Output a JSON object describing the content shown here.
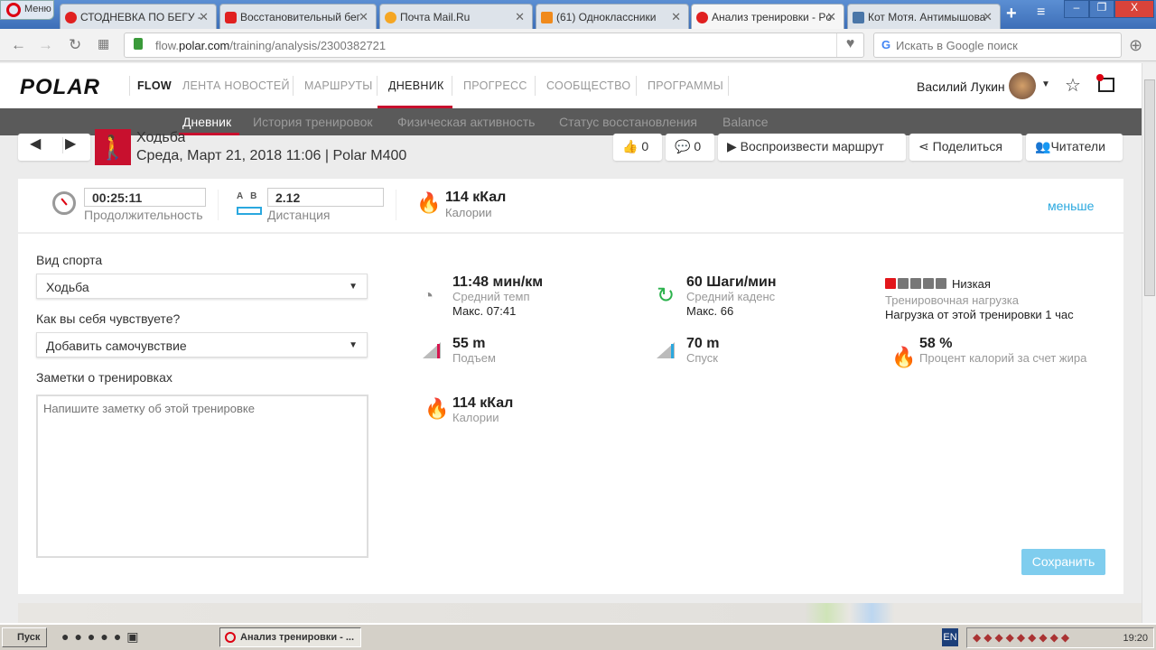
{
  "browser": {
    "menu_label": "Меню",
    "tabs": [
      {
        "title": "СТОДНЕВКА ПО БЕГУ -",
        "color": "#e02020"
      },
      {
        "title": "Восстановительный бег",
        "color": "#e02020"
      },
      {
        "title": "Почта Mail.Ru",
        "color": "#f5a623"
      },
      {
        "title": "(61) Одноклассники",
        "color": "#f08a1c"
      },
      {
        "title": "Анализ тренировки - Po",
        "color": "#e02020"
      },
      {
        "title": "Кот Мотя. Антимышова",
        "color": "#4a76a8"
      }
    ],
    "url_prefix": "flow.",
    "url_domain": "polar.com",
    "url_path": "/training/analysis/2300382721",
    "search_placeholder": "Искать в Google поиск"
  },
  "header": {
    "logo": "POLAR",
    "flow": "FLOW",
    "nav": [
      "ЛЕНТА НОВОСТЕЙ",
      "МАРШРУТЫ",
      "ДНЕВНИК",
      "ПРОГРЕСС",
      "СООБЩЕСТВО",
      "ПРОГРАММЫ"
    ],
    "user": "Василий Лукин"
  },
  "subnav": [
    "Дневник",
    "История тренировок",
    "Физическая активность",
    "Статус восстановления",
    "Balance"
  ],
  "training": {
    "sport": "Ходьба",
    "date": "Среда, Март 21, 2018 11:06 | Polar M400",
    "likes": "0",
    "comments": "0",
    "play_route": "Воспроизвести маршрут",
    "share": "Поделиться",
    "followers": "Читатели"
  },
  "summary": {
    "duration": "00:25:11",
    "duration_label": "Продолжительность",
    "ab": "A   B",
    "distance": "2.12",
    "distance_label": "Дистанция",
    "calories": "114 кКал",
    "calories_label": "Калории",
    "less": "меньше"
  },
  "form": {
    "sport_label": "Вид спорта",
    "sport_value": "Ходьба",
    "feel_label": "Как вы себя чувствуете?",
    "feel_value": "Добавить самочувствие",
    "notes_label": "Заметки о тренировках",
    "notes_placeholder": "Напишите заметку об этой тренировке",
    "save": "Сохранить"
  },
  "stats": {
    "pace": {
      "value": "11:48 мин/км",
      "label": "Средний темп",
      "max": "Макс. 07:41"
    },
    "cadence": {
      "value": "60 Шаги/мин",
      "label": "Средний каденс",
      "max": "Макс. 66"
    },
    "load": {
      "level": "Низкая",
      "level_of_5": 1,
      "label": "Тренировочная нагрузка",
      "detail": "Нагрузка от этой тренировки 1 час"
    },
    "ascent": {
      "value": "55 m",
      "label": "Подъем"
    },
    "descent": {
      "value": "70 m",
      "label": "Спуск"
    },
    "fat": {
      "value": "58 %",
      "label": "Процент калорий за счет жира"
    },
    "calories": {
      "value": "114 кКал",
      "label": "Калории"
    }
  },
  "taskbar": {
    "start": "Пуск",
    "task": "Анализ тренировки - ...",
    "lang": "EN",
    "time": "19:20"
  }
}
